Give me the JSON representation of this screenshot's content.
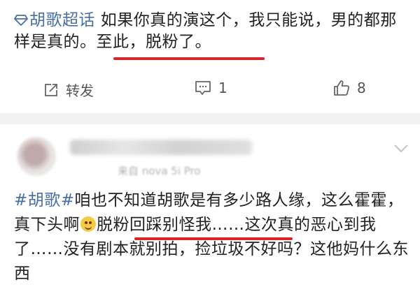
{
  "post1": {
    "topic": "胡歌超话",
    "text_line": " 如果你真的演这个，我只能说，男的都那样是真的。",
    "highlight": "至此，脱粉了。",
    "actions": {
      "repost_label": "转发",
      "comment_count": "1",
      "like_count": "8"
    }
  },
  "post2": {
    "meta": "来自 nova 5i Pro",
    "hashtag": "#胡歌#",
    "text_part1": "咱也不知道胡歌是有多少路人缘，这么霍霍，真下头啊",
    "highlight": "脱粉回踩别怪我……",
    "text_part2": "这次真的恶心到我了……没有剧本就别拍，捡垃圾不好吗？这他妈什么东西"
  },
  "icons": {
    "topic": "diamond-icon",
    "repost": "share-icon",
    "comment": "comment-icon",
    "like": "thumbs-up-icon",
    "menu": "chevron-down-icon",
    "emoji": "smiley-emoji-icon"
  },
  "colors": {
    "link": "#4a6fa5",
    "underline": "#d8242b",
    "separator": "#f2f2f2"
  }
}
